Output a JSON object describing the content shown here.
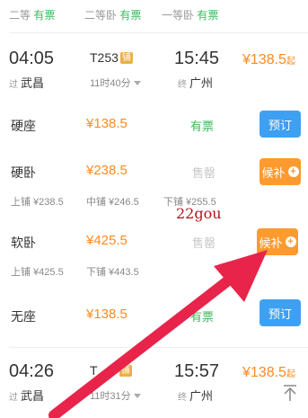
{
  "top_row": [
    {
      "label": "二等",
      "status": "有票"
    },
    {
      "label": "二等卧",
      "status": "有票"
    },
    {
      "label": "一等卧",
      "status": "有票"
    }
  ],
  "train1": {
    "dep_time": "04:05",
    "dep_tag": "过",
    "dep_station": "武昌",
    "train_no": "T253",
    "badge": "铺",
    "duration": "11时40分",
    "arr_time": "15:45",
    "arr_tag": "终",
    "arr_station": "广州",
    "price": "¥138.5",
    "price_suffix": "起"
  },
  "seats": [
    {
      "name": "硬座",
      "price": "¥138.5",
      "status": "有票",
      "button": "预订"
    },
    {
      "name": "硬卧",
      "price": "¥238.5",
      "status": "售罄",
      "button": "候补",
      "berths": [
        "上铺 ¥238.5",
        "中铺 ¥246.5",
        "下铺 ¥255.5"
      ]
    },
    {
      "name": "软卧",
      "price": "¥425.5",
      "status": "售罄",
      "button": "候补",
      "berths": [
        "上铺 ¥425.5",
        "下铺 ¥443.5"
      ]
    },
    {
      "name": "无座",
      "price": "¥138.5",
      "status": "有票",
      "button": "预订"
    }
  ],
  "watermark": "22gou",
  "train2": {
    "dep_time": "04:26",
    "dep_tag": "过",
    "dep_station": "武昌",
    "train_no": "T",
    "badge": "铺",
    "duration": "11时31分",
    "arr_time": "15:57",
    "arr_tag": "终",
    "arr_station": "广州",
    "price": "¥138.5",
    "price_suffix": "起"
  },
  "colors": {
    "green": "#3bb95e",
    "orange": "#ff8a1f",
    "blue_button": "#3ea0f2",
    "orange_button": "#ff9a2e",
    "arrow": "#e8244a"
  }
}
